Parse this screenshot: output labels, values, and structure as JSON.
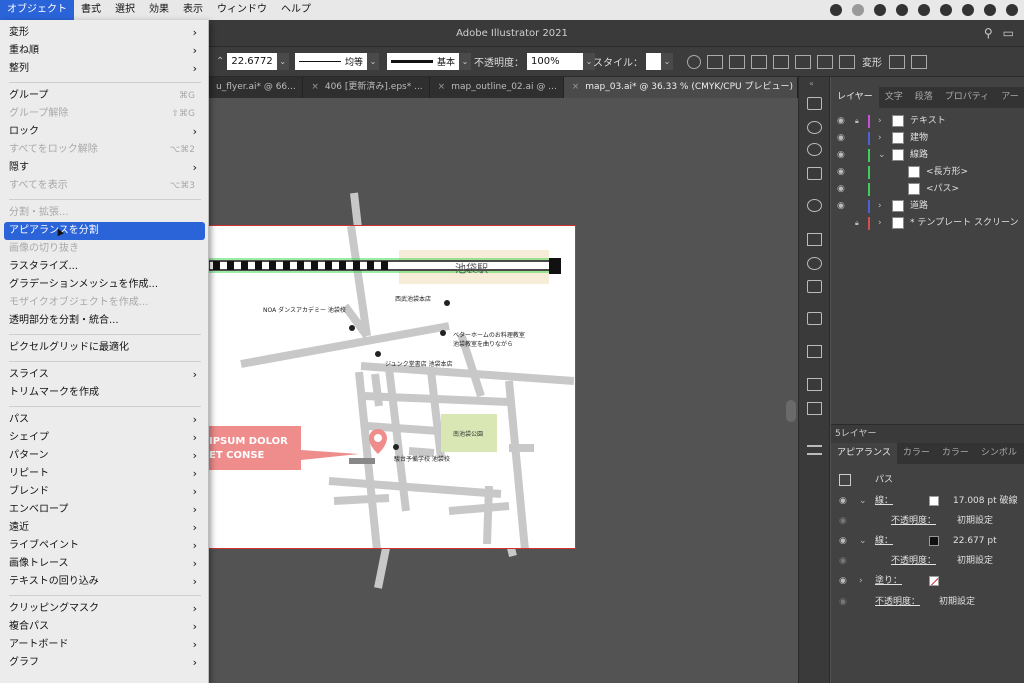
{
  "menubar": {
    "items": [
      "オブジェクト",
      "書式",
      "選択",
      "効果",
      "表示",
      "ウィンドウ",
      "ヘルプ"
    ],
    "active_index": 0
  },
  "titlebar": {
    "title": "Adobe Illustrator 2021"
  },
  "controlbar": {
    "stroke_width": "22.6772",
    "profile_label": "均等",
    "brush_label": "基本",
    "opacity_label": "不透明度：",
    "opacity_value": "100%",
    "style_label": "スタイル：",
    "transform_label": "変形"
  },
  "doc_tabs": [
    {
      "label": "u_flyer.ai* @ 66...",
      "active": false
    },
    {
      "label": "406 [更新済み].eps* ...",
      "active": false
    },
    {
      "label": "map_outline_02.ai @ ...",
      "active": false
    },
    {
      "label": "map_03.ai* @ 36.33 % (CMYK/CPU プレビュー)",
      "active": true
    }
  ],
  "menu": {
    "rows": [
      {
        "label": "変形",
        "arrow": true,
        "disabled": false
      },
      {
        "label": "重ね順",
        "arrow": true,
        "disabled": false
      },
      {
        "label": "整列",
        "arrow": true,
        "disabled": false
      },
      {
        "sep": true
      },
      {
        "label": "グループ",
        "shortcut": "⌘G",
        "disabled": false
      },
      {
        "label": "グループ解除",
        "shortcut": "⇧⌘G",
        "disabled": true
      },
      {
        "label": "ロック",
        "arrow": true,
        "disabled": false
      },
      {
        "label": "すべてをロック解除",
        "shortcut": "⌥⌘2",
        "disabled": true
      },
      {
        "label": "隠す",
        "arrow": true,
        "disabled": false
      },
      {
        "label": "すべてを表示",
        "shortcut": "⌥⌘3",
        "disabled": true
      },
      {
        "sep": true
      },
      {
        "label": "分割・拡張...",
        "disabled": true
      },
      {
        "label": "アピアランスを分割",
        "disabled": false,
        "highlighted": true
      },
      {
        "label": "画像の切り抜き",
        "disabled": true
      },
      {
        "label": "ラスタライズ...",
        "disabled": false
      },
      {
        "label": "グラデーションメッシュを作成...",
        "disabled": false
      },
      {
        "label": "モザイクオブジェクトを作成...",
        "disabled": true
      },
      {
        "label": "透明部分を分割・統合...",
        "disabled": false
      },
      {
        "sep": true
      },
      {
        "label": "ピクセルグリッドに最適化",
        "disabled": false
      },
      {
        "sep": true
      },
      {
        "label": "スライス",
        "arrow": true,
        "disabled": false
      },
      {
        "label": "トリムマークを作成",
        "disabled": false
      },
      {
        "sep": true
      },
      {
        "label": "パス",
        "arrow": true,
        "disabled": false
      },
      {
        "label": "シェイプ",
        "arrow": true,
        "disabled": false
      },
      {
        "label": "パターン",
        "arrow": true,
        "disabled": false
      },
      {
        "label": "リピート",
        "arrow": true,
        "disabled": false
      },
      {
        "label": "ブレンド",
        "arrow": true,
        "disabled": false
      },
      {
        "label": "エンベロープ",
        "arrow": true,
        "disabled": false
      },
      {
        "label": "遠近",
        "arrow": true,
        "disabled": false
      },
      {
        "label": "ライブペイント",
        "arrow": true,
        "disabled": false
      },
      {
        "label": "画像トレース",
        "arrow": true,
        "disabled": false
      },
      {
        "label": "テキストの回り込み",
        "arrow": true,
        "disabled": false
      },
      {
        "sep": true
      },
      {
        "label": "クリッピングマスク",
        "arrow": true,
        "disabled": false
      },
      {
        "label": "複合パス",
        "arrow": true,
        "disabled": false
      },
      {
        "label": "アートボード",
        "arrow": true,
        "disabled": false
      },
      {
        "label": "グラフ",
        "arrow": true,
        "disabled": false
      }
    ]
  },
  "map": {
    "station": "池袋駅",
    "park": "南池袋公園",
    "labels": [
      "西武池袋本店",
      "NOA ダンスアカデミー 池袋校",
      "ベターホームのお料理教室",
      "池袋教室を曲りながら",
      "ジュンク堂書店 池袋本店",
      "駿台予備学校 池袋校"
    ],
    "banner": [
      "IPSUM DOLOR",
      "ET CONSE"
    ]
  },
  "layers_panel": {
    "tabs": [
      "レイヤー",
      "文字",
      "段落",
      "プロパティ",
      "アー"
    ],
    "rows": [
      {
        "label": "テキスト",
        "color": "#c94fd6",
        "indent": 0
      },
      {
        "label": "建物",
        "color": "#4f5fd6",
        "indent": 0
      },
      {
        "label": "線路",
        "color": "#3fcf5a",
        "indent": 0
      },
      {
        "label": "<長方形>",
        "color": "#3fcf5a",
        "indent": 1
      },
      {
        "label": "<パス>",
        "color": "#3fcf5a",
        "indent": 1
      },
      {
        "label": "道路",
        "color": "#4f5fd6",
        "indent": 0
      },
      {
        "label": "* テンプレート スクリーン",
        "color": "#d64f4f",
        "indent": 0
      }
    ],
    "footer": "5レイヤー"
  },
  "appearance_panel": {
    "tabs": [
      "アピアランス",
      "カラー",
      "カラー",
      "シンボル",
      "ブ"
    ],
    "header": "パス",
    "stroke1_label": "線：",
    "stroke1_value": "17.008 pt 破線",
    "opacity_label": "不透明度：",
    "opacity_value": "初期設定",
    "stroke2_label": "線：",
    "stroke2_value": "22.677 pt",
    "opacity2_label": "不透明度：",
    "opacity2_value": "初期設定",
    "fill_label": "塗り：",
    "opacity3_label": "不透明度：",
    "opacity3_value": "初期設定"
  }
}
